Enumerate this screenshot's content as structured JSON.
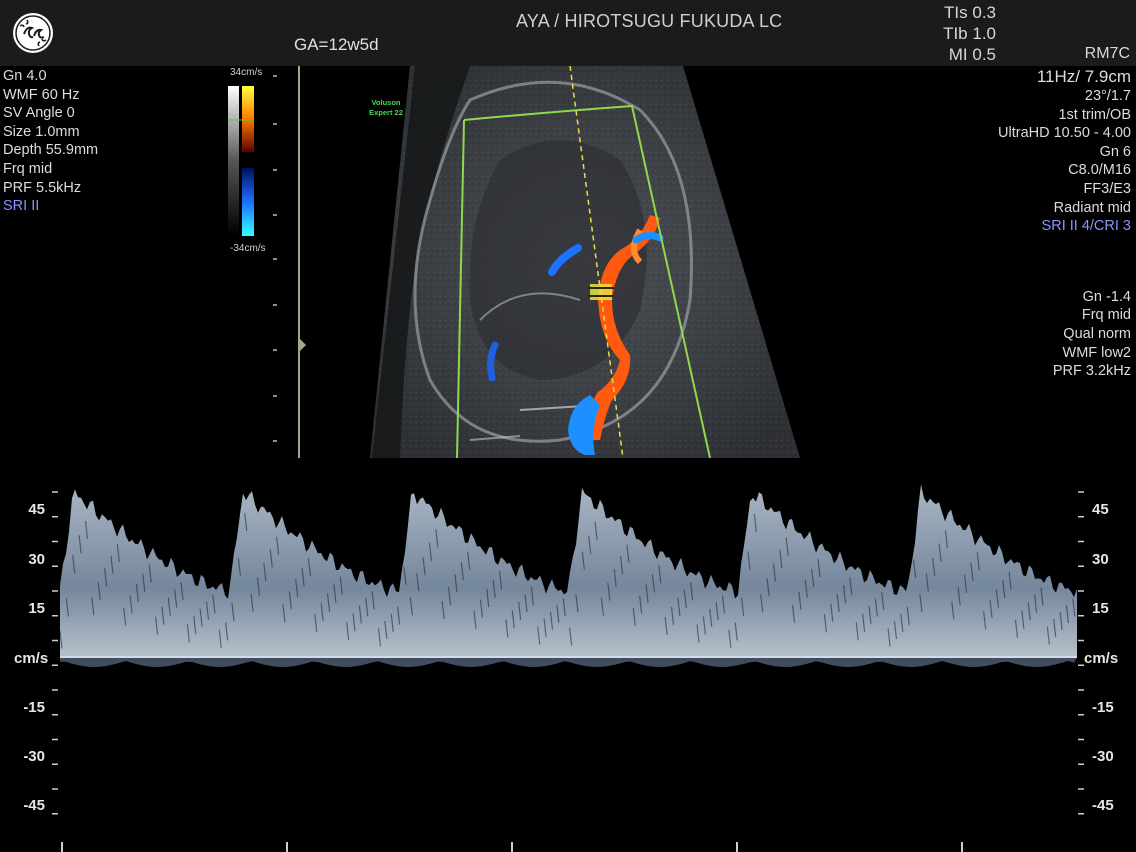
{
  "header": {
    "logo_icon": "ge-logo-icon",
    "title": "AYA / HIROTSUGU FUKUDA LC",
    "ga": "GA=12w5d",
    "indices": [
      {
        "label": "TIs",
        "value": "0.3"
      },
      {
        "label": "TIb",
        "value": "1.0"
      },
      {
        "label": "MI",
        "value": "0.5"
      }
    ],
    "probe": "RM7C"
  },
  "left_panel": {
    "lines": [
      "Gn  4.0",
      "WMF 60 Hz",
      "SV Angle  0",
      "Size  1.0mm",
      "Depth 55.9mm",
      "Frq mid",
      "PRF  5.5kHz"
    ],
    "sri": "SRI II"
  },
  "color_scale": {
    "top": "34cm/s",
    "bottom": "-34cm/s"
  },
  "brand": {
    "line1": "Voluson",
    "line2": "Expert 22"
  },
  "right_panel": {
    "rate": "11Hz/ 7.9cm",
    "lines": [
      "23°/1.7",
      "1st trim/OB",
      "UltraHD 10.50 - 4.00",
      "Gn   6",
      "C8.0/M16",
      "FF3/E3",
      "Radiant mid"
    ],
    "sri": "SRI II 4/CRI 3",
    "doppler_lines": [
      "Gn -1.4",
      "Frq mid",
      "Qual norm",
      "WMF low2",
      "PRF  3.2kHz"
    ]
  },
  "spectral": {
    "unit": "cm/s",
    "ticks": [
      "45",
      "30",
      "15",
      "-15",
      "-30",
      "-45"
    ],
    "cycles": 6,
    "peak_velocity": 50,
    "trough_velocity": 20
  },
  "colors": {
    "header_bg": "#1b1b1b",
    "sector_outline": "#8fd94a",
    "sri": "#8a93ff",
    "doppler_flow_toward": "#ff5a10",
    "doppler_flow_away": "#1e8fff"
  }
}
